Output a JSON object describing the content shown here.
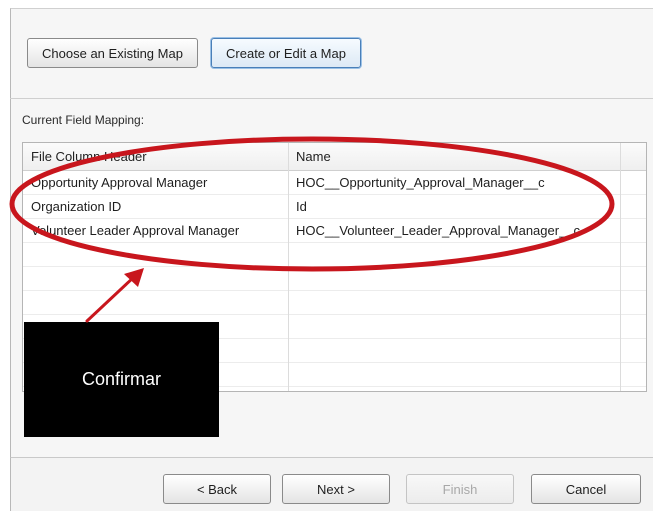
{
  "buttons": {
    "choose_existing": "Choose an Existing Map",
    "create_edit": "Create or Edit a Map"
  },
  "mapping": {
    "label": "Current Field Mapping:",
    "columns": [
      "File Column Header",
      "Name"
    ],
    "rows": [
      [
        "Opportunity Approval Manager",
        "HOC__Opportunity_Approval_Manager__c"
      ],
      [
        "Organization ID",
        "Id"
      ],
      [
        "Volunteer Leader Approval Manager",
        "HOC__Volunteer_Leader_Approval_Manager__c"
      ],
      [
        "",
        ""
      ],
      [
        "",
        ""
      ],
      [
        "",
        ""
      ],
      [
        "",
        ""
      ],
      [
        "",
        ""
      ],
      [
        "",
        ""
      ],
      [
        "",
        ""
      ]
    ]
  },
  "annotation": {
    "label": "Confirmar",
    "color": "#c8161d"
  },
  "footer": {
    "back": "< Back",
    "next": "Next >",
    "finish": "Finish",
    "cancel": "Cancel"
  }
}
